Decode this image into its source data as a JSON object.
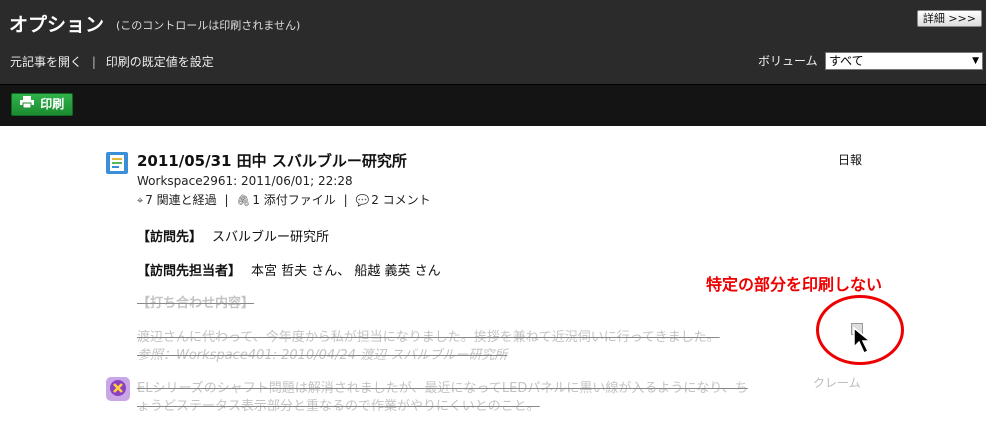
{
  "header": {
    "title": "オプション",
    "subtitle": "(このコントロールは印刷されません)",
    "details_button": "詳細 >>>",
    "links": [
      "元記事を開く",
      "印刷の既定値を設定"
    ],
    "link_separator": "|",
    "volume_label": "ボリューム",
    "volume_value": "すべて",
    "print_button": "印刷",
    "print_icon": "printer-icon"
  },
  "entry": {
    "icon": "report-icon",
    "title": "2011/05/31 田中 スバルブルー研究所",
    "type": "日報",
    "meta": "Workspace2961:  2011/06/01; 22:28",
    "links": {
      "related": "7 関連と経過",
      "attachments": "1 添付ファイル",
      "comments": "2 コメント",
      "separator": "|"
    },
    "fields": [
      {
        "label": "【訪問先】",
        "value": "スバルブルー研究所"
      },
      {
        "label": "【訪問先担当者】",
        "value": "本宮 哲夫 さん、 船越 義英 さん"
      }
    ],
    "struck": {
      "heading": "【打ち合わせ内容】",
      "line1": "渡辺さんに代わって、今年度から私が担当になりました。挨拶を兼ねて近況伺いに行ってきました。",
      "line2": "参照：Workspace401: 2010/04/24 渡辺 スバルブルー研究所"
    }
  },
  "entry2": {
    "icon": "claim-icon",
    "line1": "ELシリーズのシャフト問題は解消されましたが、最近になってLEDパネルに黒い線が入るようになり、ち",
    "line2": "ょうどステータス表示部分と重なるので作業がやりにくいとのこと。",
    "type": "クレーム"
  },
  "annotation": {
    "text": "特定の部分を印刷しない",
    "color": "#e00000"
  },
  "colors": {
    "header_bg": "#2b2b2b",
    "toolbar_bg": "#141414",
    "print_green": "#1c8c30"
  }
}
